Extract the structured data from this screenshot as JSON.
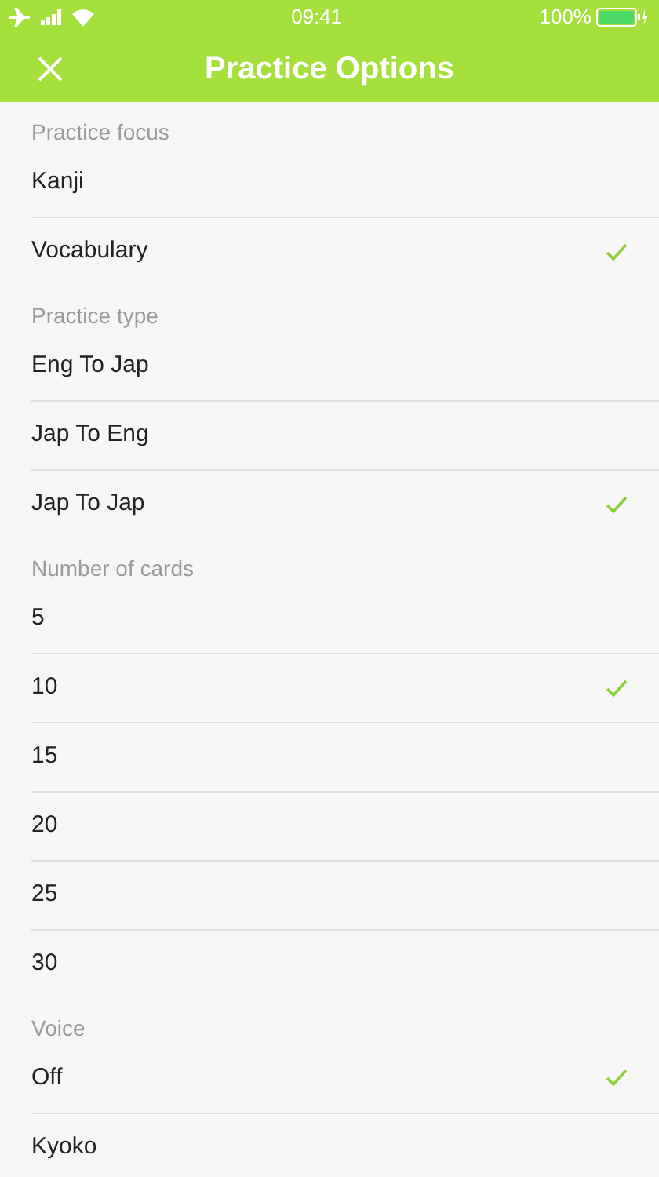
{
  "status_bar": {
    "time": "09:41",
    "battery": "100%"
  },
  "header": {
    "title": "Practice Options"
  },
  "sections": [
    {
      "title": "Practice focus",
      "options": [
        {
          "label": "Kanji",
          "selected": false
        },
        {
          "label": "Vocabulary",
          "selected": true
        }
      ]
    },
    {
      "title": "Practice type",
      "options": [
        {
          "label": "Eng To Jap",
          "selected": false
        },
        {
          "label": "Jap To Eng",
          "selected": false
        },
        {
          "label": "Jap To Jap",
          "selected": true
        }
      ]
    },
    {
      "title": "Number of cards",
      "options": [
        {
          "label": "5",
          "selected": false
        },
        {
          "label": "10",
          "selected": true
        },
        {
          "label": "15",
          "selected": false
        },
        {
          "label": "20",
          "selected": false
        },
        {
          "label": "25",
          "selected": false
        },
        {
          "label": "30",
          "selected": false
        }
      ]
    },
    {
      "title": "Voice",
      "options": [
        {
          "label": "Off",
          "selected": true
        },
        {
          "label": "Kyoko",
          "selected": false
        }
      ]
    }
  ]
}
